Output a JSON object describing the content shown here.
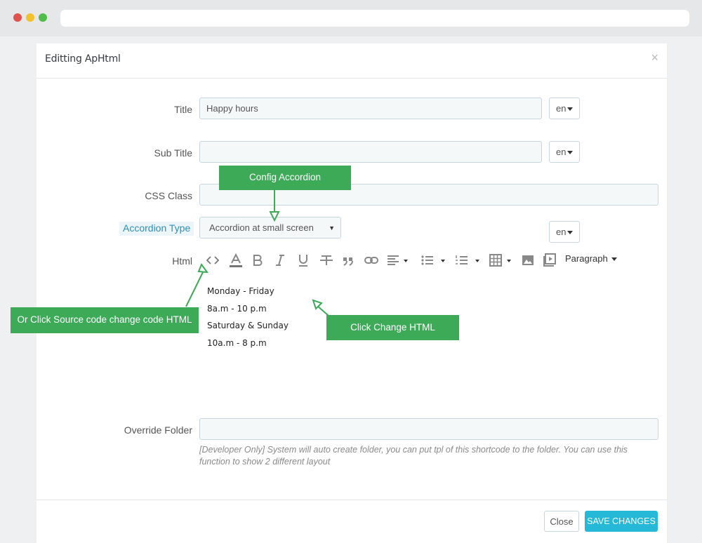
{
  "modal": {
    "title": "Editting ApHtml",
    "close_glyph": "×"
  },
  "form": {
    "title_label": "Title",
    "title_value": "Happy hours",
    "subtitle_label": "Sub Title",
    "subtitle_value": "",
    "css_class_label": "CSS Class",
    "css_class_value": "",
    "accordion_type_label": "Accordion Type",
    "accordion_type_value": "Accordion at small screen",
    "html_label": "Html",
    "override_folder_label": "Override Folder",
    "override_folder_value": "",
    "override_help": "[Developer Only] System will auto create folder, you can put tpl of this shortcode to the folder. You can use this function to show 2 different layout",
    "lang": "en"
  },
  "editor": {
    "toolbar_icons": [
      "source-code-icon",
      "font-color-icon",
      "bold-icon",
      "italic-icon",
      "underline-icon",
      "strikethrough-icon",
      "blockquote-icon",
      "link-icon",
      "align-icon",
      "bullet-list-icon",
      "numbered-list-icon",
      "table-icon",
      "image-icon",
      "video-icon"
    ],
    "paragraph_label": "Paragraph",
    "lines": [
      "Monday - Friday",
      "8a.m - 10 p.m",
      "Saturday & Sunday",
      "10a.m - 8 p.m"
    ]
  },
  "footer": {
    "close_label": "Close",
    "save_label": "SAVE CHANGES"
  },
  "annotations": {
    "config_accordion": "Config Accordion",
    "source_code": "Or Click Source code change code HTML",
    "change_html": "Click Change HTML"
  },
  "colors": {
    "accent": "#25b9d7",
    "annotation": "#3daa58"
  }
}
